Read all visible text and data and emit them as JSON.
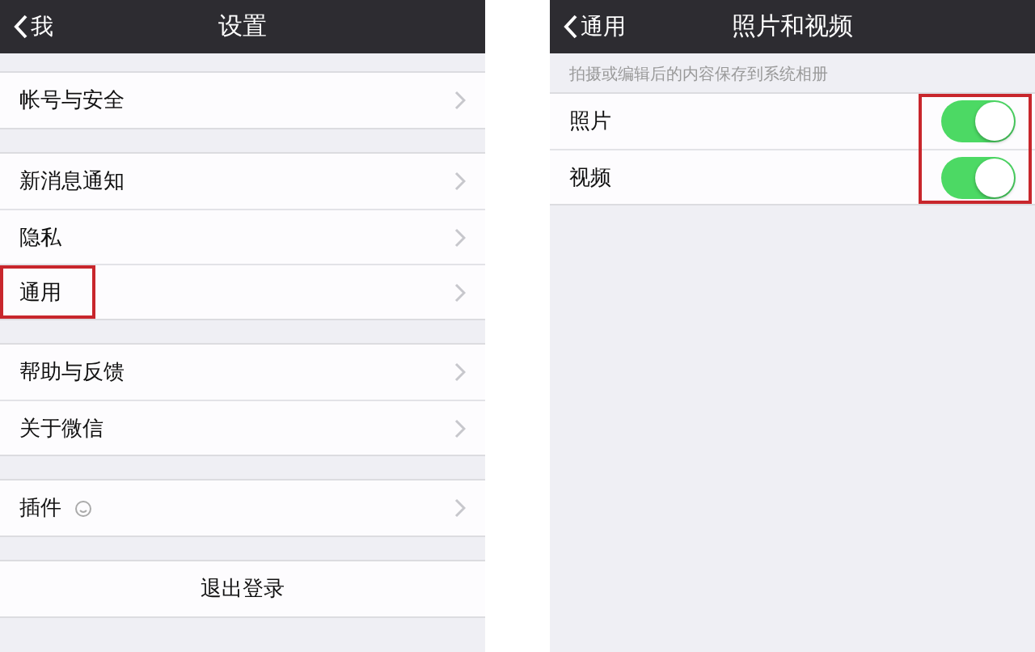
{
  "screens": [
    {
      "nav": {
        "back": "我",
        "title": "设置"
      },
      "groups": [
        {
          "items": [
            {
              "kind": "link",
              "label": "帐号与安全",
              "highlighted": false
            }
          ]
        },
        {
          "items": [
            {
              "kind": "link",
              "label": "新消息通知",
              "highlighted": false
            },
            {
              "kind": "link",
              "label": "隐私",
              "highlighted": false
            },
            {
              "kind": "link",
              "label": "通用",
              "highlighted": true
            }
          ]
        },
        {
          "items": [
            {
              "kind": "link",
              "label": "帮助与反馈",
              "highlighted": false
            },
            {
              "kind": "link",
              "label": "关于微信",
              "highlighted": false
            }
          ]
        },
        {
          "items": [
            {
              "kind": "plugin",
              "label": "插件",
              "highlighted": false
            }
          ]
        },
        {
          "items": [
            {
              "kind": "action",
              "label": "退出登录",
              "highlighted": false
            }
          ]
        }
      ]
    },
    {
      "nav": {
        "back": "通用",
        "title": "照片和视频"
      },
      "groups": [
        {
          "caption": "拍摄或编辑后的内容保存到系统相册",
          "toggles_highlighted": true,
          "items": [
            {
              "kind": "toggle",
              "label": "照片",
              "on": true
            },
            {
              "kind": "toggle",
              "label": "视频",
              "on": true
            }
          ]
        }
      ]
    }
  ]
}
